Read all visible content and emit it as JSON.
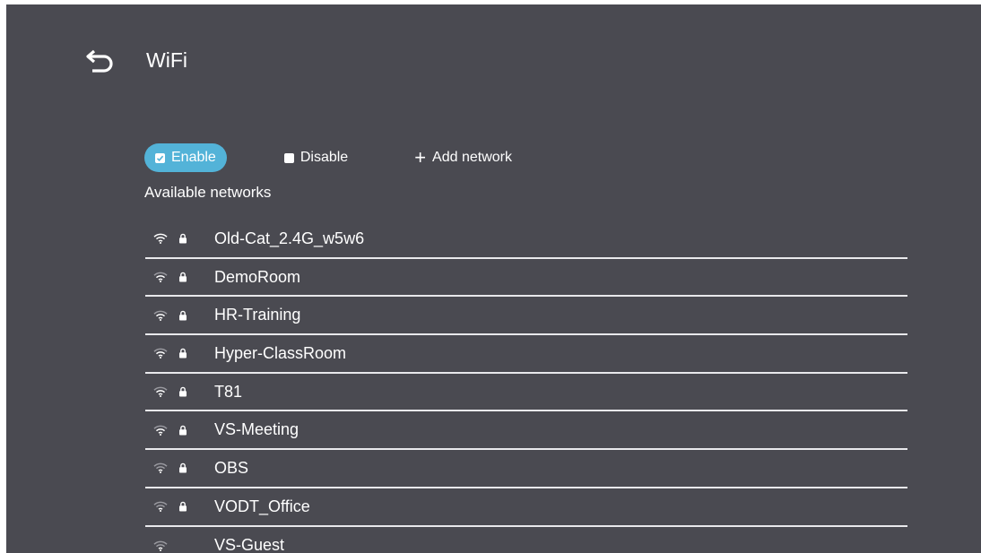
{
  "header": {
    "title": "WiFi"
  },
  "options": {
    "enable_label": "Enable",
    "disable_label": "Disable",
    "add_label": "Add network",
    "accent": "#53b3d8"
  },
  "section_label": "Available networks",
  "networks": [
    {
      "ssid": "Old-Cat_2.4G_w5w6",
      "secured": true,
      "signal_icon": "wifi-strong-icon"
    },
    {
      "ssid": "DemoRoom",
      "secured": true,
      "signal_icon": "wifi-medium-icon"
    },
    {
      "ssid": "HR-Training",
      "secured": true,
      "signal_icon": "wifi-medium-icon"
    },
    {
      "ssid": "Hyper-ClassRoom",
      "secured": true,
      "signal_icon": "wifi-medium-icon"
    },
    {
      "ssid": "T81",
      "secured": true,
      "signal_icon": "wifi-medium-icon"
    },
    {
      "ssid": "VS-Meeting",
      "secured": true,
      "signal_icon": "wifi-medium-icon"
    },
    {
      "ssid": "OBS",
      "secured": true,
      "signal_icon": "wifi-weak-icon"
    },
    {
      "ssid": "VODT_Office",
      "secured": true,
      "signal_icon": "wifi-weak-icon"
    },
    {
      "ssid": "VS-Guest",
      "secured": false,
      "signal_icon": "wifi-weak-icon"
    }
  ]
}
